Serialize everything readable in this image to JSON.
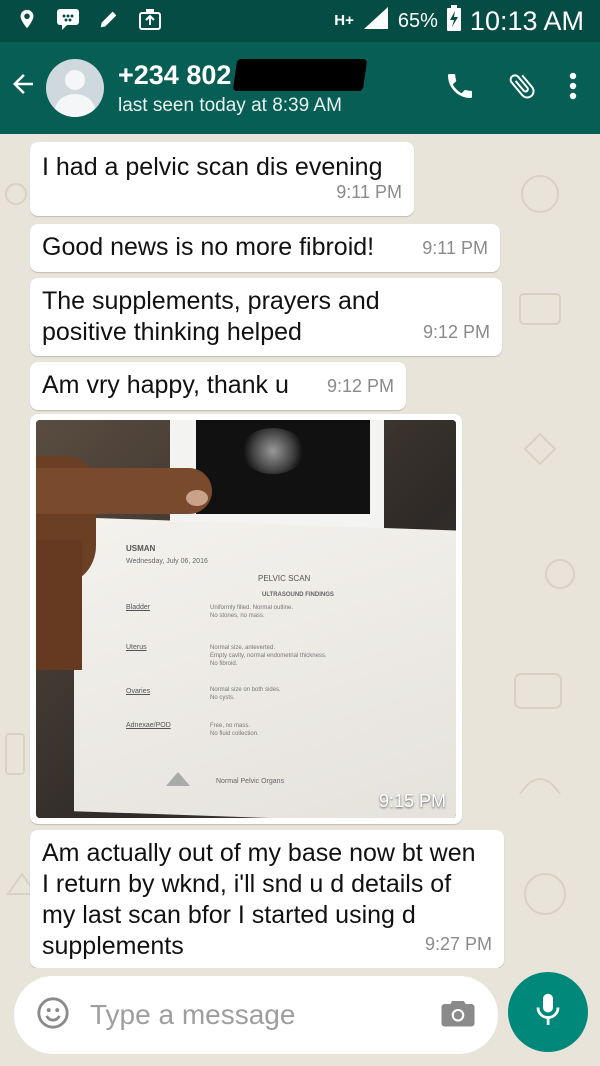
{
  "status_bar": {
    "network": "H+",
    "battery": "65%",
    "time": "10:13 AM"
  },
  "header": {
    "contact_name": "+234 802",
    "subtitle": "last seen today at 8:39 AM"
  },
  "messages": [
    {
      "text": "I had a pelvic scan dis evening",
      "time": "9:11 PM"
    },
    {
      "text": "Good news is no more fibroid!",
      "time": "9:11 PM"
    },
    {
      "text": "The supplements, prayers and positive thinking helped",
      "time": "9:12 PM"
    },
    {
      "text": "Am vry happy, thank u",
      "time": "9:12 PM"
    },
    {
      "text": "Am actually out of my base now bt wen I return by wknd, i'll snd u d details of my last scan bfor I started using d supplements",
      "time": "9:27 PM"
    }
  ],
  "image_message": {
    "time": "9:15 PM",
    "doc": {
      "patient": "USMAN",
      "date": "Wednesday, July 06, 2016",
      "heading": "PELVIC SCAN",
      "subheading": "ULTRASOUND FINDINGS",
      "rows": [
        {
          "label": "Bladder",
          "lines": [
            "Uniformly filled. Normal outline.",
            "No stones, no mass."
          ]
        },
        {
          "label": "Uterus",
          "lines": [
            "Normal size, anteverted.",
            "Empty cavity, normal endometrial thickness.",
            "No fibroid."
          ]
        },
        {
          "label": "Ovaries",
          "lines": [
            "Normal size on both sides.",
            "No cysts."
          ]
        },
        {
          "label": "Adnexae/POD",
          "lines": [
            "Free, no mass.",
            "No fluid collection."
          ]
        }
      ],
      "conclusion": "Normal Pelvic Organs"
    }
  },
  "composer": {
    "placeholder": "Type a message"
  },
  "colors": {
    "header": "#075e54",
    "statusbar": "#054d44",
    "chat_bg": "#e9e4d9",
    "fab": "#00897b"
  }
}
